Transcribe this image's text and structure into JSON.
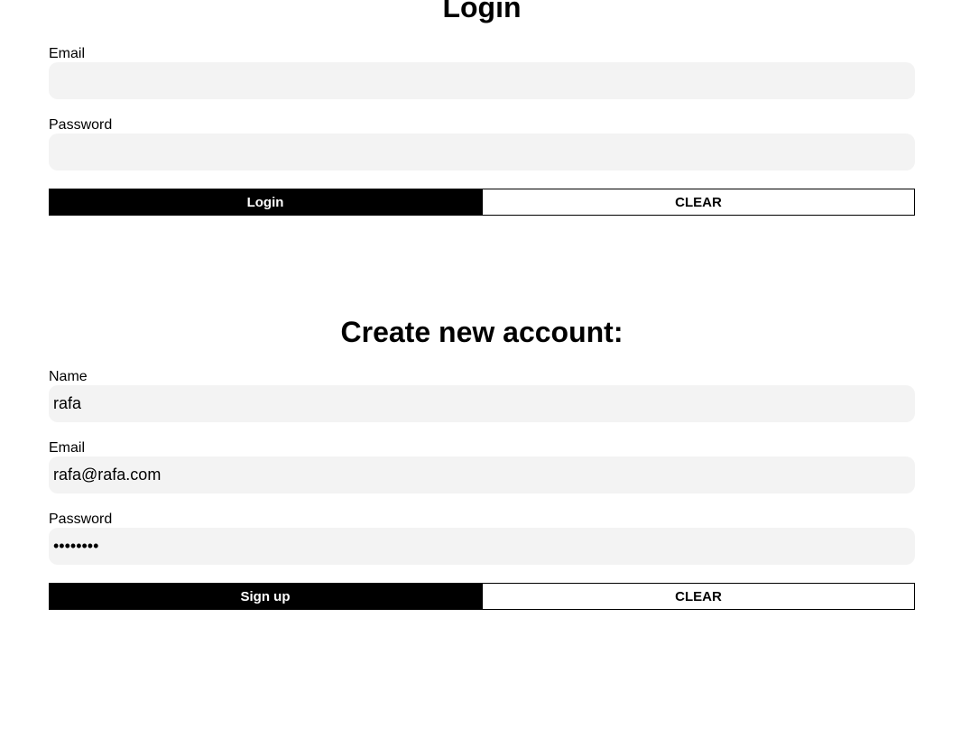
{
  "login": {
    "title": "Login",
    "email_label": "Email",
    "email_value": "",
    "password_label": "Password",
    "password_value": "",
    "submit_label": "Login",
    "clear_label": "CLEAR"
  },
  "signup": {
    "title": "Create new account:",
    "name_label": "Name",
    "name_value": "rafa",
    "email_label": "Email",
    "email_value": "rafa@rafa.com",
    "password_label": "Password",
    "password_value": "••••••••",
    "submit_label": "Sign up",
    "clear_label": "CLEAR"
  },
  "colors": {
    "input_bg": "#f3f3f3",
    "primary": "#000000",
    "secondary_bg": "#ffffff"
  }
}
